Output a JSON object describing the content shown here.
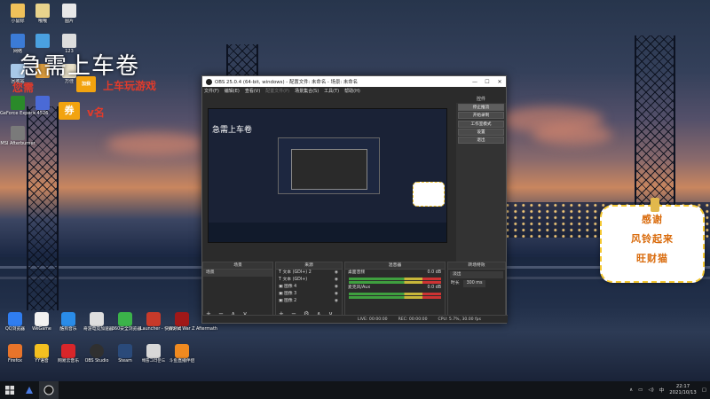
{
  "desktop": {
    "left_icons": [
      {
        "label": "小鼠标",
        "color": "#f0c15a"
      },
      {
        "label": "哦哦",
        "color": "#e8d38c"
      },
      {
        "label": "图片",
        "color": "#e8e8e8"
      },
      {
        "label": "网络",
        "color": "#3b7bd6"
      },
      {
        "label": "",
        "color": "#4aa0e0"
      },
      {
        "label": "123",
        "color": "#dddddd"
      },
      {
        "label": "回收站",
        "color": "#a8c8e8"
      },
      {
        "label": "",
        "color": "#e0a040"
      },
      {
        "label": "万佳",
        "color": "#e8e0c8"
      },
      {
        "label": "GeForce Experience",
        "color": "#2a8a2a"
      },
      {
        "label": "4526",
        "color": "#4a6ad6"
      },
      {
        "label": "MSI Afterburner",
        "color": "#7a7a7a"
      }
    ],
    "bottom_icons": [
      {
        "label": "QQ浏览器",
        "color": "#2f7df0"
      },
      {
        "label": "WeGame",
        "color": "#f2f2f2"
      },
      {
        "label": "酷狗音乐",
        "color": "#2a8ce8"
      },
      {
        "label": "奇游电竞加速器",
        "color": "#dedede"
      },
      {
        "label": "360安全浏览器",
        "color": "#3bb34a"
      },
      {
        "label": "Launcher - 快捷方式",
        "color": "#c83a2a"
      },
      {
        "label": "World War Z Aftermath",
        "color": "#a01818"
      },
      {
        "label": "Firefox",
        "color": "#e8742a"
      },
      {
        "label": "YY语音",
        "color": "#f4c020"
      },
      {
        "label": "网易云音乐",
        "color": "#d8262a"
      },
      {
        "label": "OBS Studio",
        "color": "#303030"
      },
      {
        "label": "Steam",
        "color": "#2a4a7a"
      },
      {
        "label": "배틀그라운드",
        "color": "#d8d8d8"
      },
      {
        "label": "斗鱼直播伴侣",
        "color": "#f08a20"
      }
    ]
  },
  "overlay": {
    "title": "急需上车卷",
    "line1_prefix": "您需",
    "badge_small": "加我",
    "line1_suffix": "上车玩游戏",
    "badge_big": "券",
    "badge_big_suffix": "v名"
  },
  "wish_card": {
    "line1": "感谢",
    "line2": "风铃起来",
    "line3": "旺财猫"
  },
  "obs": {
    "title": "OBS 25.0.4 (64-bit, windows) - 配置文件: 未命名 - 场景: 未命名",
    "menu": [
      "文件(F)",
      "编辑(E)",
      "查看(V)",
      "配置文件(P)",
      "场景集合(S)",
      "工具(T)",
      "帮助(H)"
    ],
    "preview_title": "急需上车卷",
    "controls_header": "控件",
    "controls": [
      "停止推流",
      "开始录制",
      "工作室模式",
      "设置",
      "退出"
    ],
    "scenes_header": "场景",
    "scenes": [
      "场景"
    ],
    "sources_header": "来源",
    "sources": [
      "文本 (GDI+) 2",
      "文本 (GDI+)",
      "图像 4",
      "图像 3",
      "图像 2"
    ],
    "mixer_header": "混音器",
    "mixer": [
      {
        "name": "桌面音频",
        "db": "0.0 dB"
      },
      {
        "name": "麦克风/Aux",
        "db": "0.0 dB"
      }
    ],
    "transition_header": "转场特效",
    "transition_type": "淡出",
    "transition_duration_label": "时长",
    "transition_duration": "300 ms",
    "status": {
      "live": "LIVE: 00:00:00",
      "rec": "REC: 00:00:00",
      "cpu": "CPU: 5.7%, 30.00 fps"
    }
  },
  "taskbar": {
    "time": "22:17",
    "date": "2021/10/13",
    "lang": "中"
  }
}
